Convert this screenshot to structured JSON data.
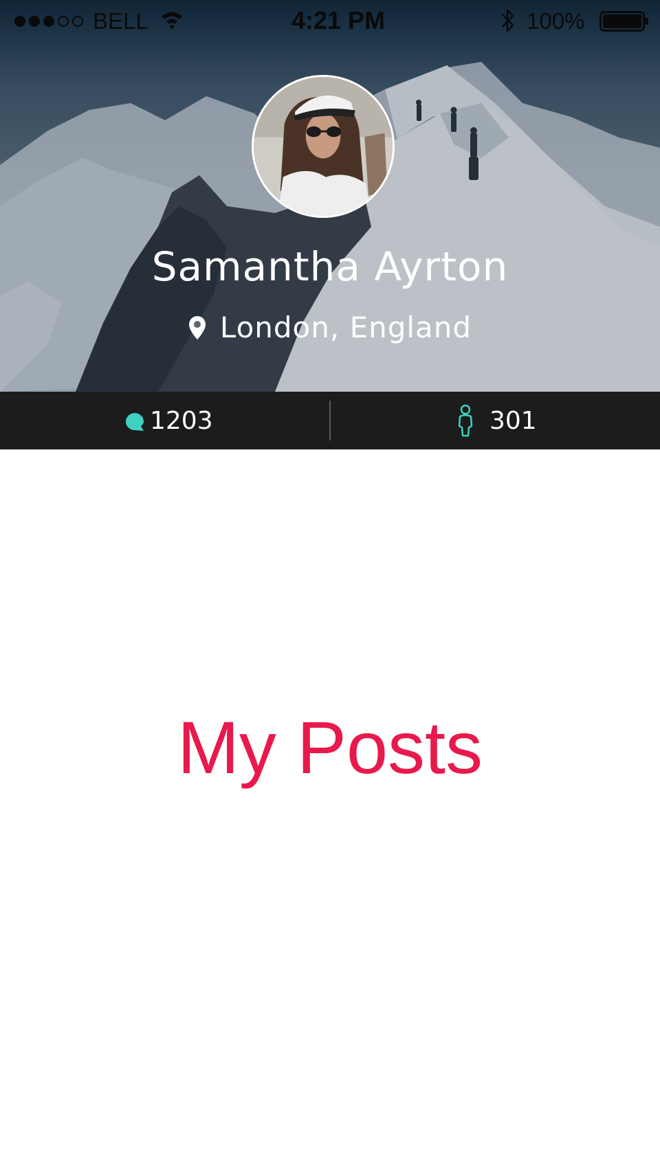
{
  "status_bar": {
    "carrier": "BELL",
    "time": "4:21 PM",
    "battery": "100%",
    "signal_bars_filled": 3,
    "signal_bars_total": 5,
    "battery_level": 1.0,
    "icons": [
      "signal-dots-icon",
      "wifi-icon",
      "bluetooth-icon",
      "battery-icon"
    ]
  },
  "profile": {
    "name": "Samantha Ayrton",
    "location": "London, England",
    "avatar_icon": "avatar-photo",
    "location_icon": "map-pin-icon"
  },
  "stats": {
    "posts_count": "1203",
    "followers_count": "301",
    "posts_icon": "chat-bubble-icon",
    "followers_icon": "person-icon"
  },
  "content": {
    "title": "My Posts"
  },
  "colors": {
    "accent_teal": "#3fd0bf",
    "title_red": "#e8194c",
    "stats_bar_bg": "#1c1c1c",
    "text_light": "#ffffff"
  }
}
